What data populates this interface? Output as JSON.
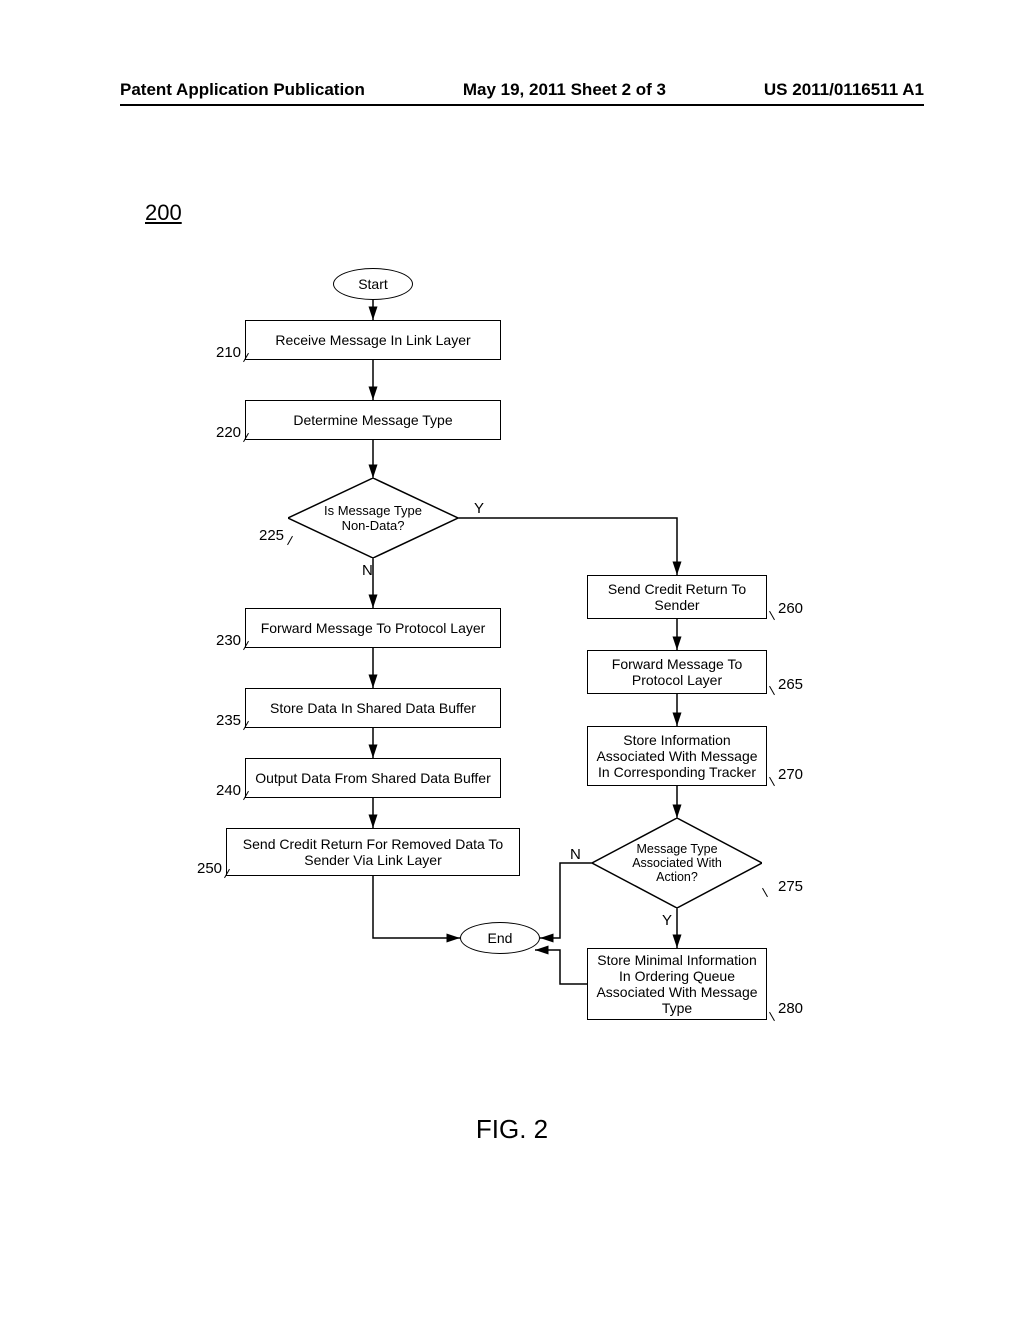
{
  "header": {
    "left": "Patent Application Publication",
    "center": "May 19, 2011  Sheet 2 of 3",
    "right": "US 2011/0116511 A1"
  },
  "figure_number": "200",
  "figure_label": "FIG. 2",
  "terminators": {
    "start": "Start",
    "end": "End"
  },
  "boxes": {
    "b210": "Receive Message In Link Layer",
    "b220": "Determine Message Type",
    "b230": "Forward Message To Protocol Layer",
    "b235": "Store Data In Shared Data Buffer",
    "b240": "Output Data From Shared Data Buffer",
    "b250": "Send Credit Return For Removed Data To Sender Via Link Layer",
    "b260": "Send Credit Return To Sender",
    "b265": "Forward Message To Protocol Layer",
    "b270": "Store Information Associated With Message In Corresponding Tracker",
    "b280": "Store Minimal Information In Ordering Queue Associated With Message Type"
  },
  "decisions": {
    "d225": "Is Message Type Non-Data?",
    "d275": "Message Type Associated With Action?"
  },
  "refs": {
    "r210": "210",
    "r220": "220",
    "r225": "225",
    "r230": "230",
    "r235": "235",
    "r240": "240",
    "r250": "250",
    "r260": "260",
    "r265": "265",
    "r270": "270",
    "r275": "275",
    "r280": "280"
  },
  "branch_labels": {
    "Y": "Y",
    "N": "N"
  },
  "chart_data": {
    "type": "flowchart",
    "nodes": [
      {
        "id": "start",
        "kind": "terminator",
        "label": "Start"
      },
      {
        "id": "210",
        "kind": "process",
        "label": "Receive Message In Link Layer"
      },
      {
        "id": "220",
        "kind": "process",
        "label": "Determine Message Type"
      },
      {
        "id": "225",
        "kind": "decision",
        "label": "Is Message Type Non-Data?"
      },
      {
        "id": "230",
        "kind": "process",
        "label": "Forward Message To Protocol Layer"
      },
      {
        "id": "235",
        "kind": "process",
        "label": "Store Data In Shared Data Buffer"
      },
      {
        "id": "240",
        "kind": "process",
        "label": "Output Data From Shared Data Buffer"
      },
      {
        "id": "250",
        "kind": "process",
        "label": "Send Credit Return For Removed Data To Sender Via Link Layer"
      },
      {
        "id": "260",
        "kind": "process",
        "label": "Send Credit Return To Sender"
      },
      {
        "id": "265",
        "kind": "process",
        "label": "Forward Message To Protocol Layer"
      },
      {
        "id": "270",
        "kind": "process",
        "label": "Store Information Associated With Message In Corresponding Tracker"
      },
      {
        "id": "275",
        "kind": "decision",
        "label": "Message Type Associated With Action?"
      },
      {
        "id": "280",
        "kind": "process",
        "label": "Store Minimal Information In Ordering Queue Associated With Message Type"
      },
      {
        "id": "end",
        "kind": "terminator",
        "label": "End"
      }
    ],
    "edges": [
      {
        "from": "start",
        "to": "210"
      },
      {
        "from": "210",
        "to": "220"
      },
      {
        "from": "220",
        "to": "225"
      },
      {
        "from": "225",
        "to": "230",
        "label": "N"
      },
      {
        "from": "225",
        "to": "260",
        "label": "Y"
      },
      {
        "from": "230",
        "to": "235"
      },
      {
        "from": "235",
        "to": "240"
      },
      {
        "from": "240",
        "to": "250"
      },
      {
        "from": "250",
        "to": "end"
      },
      {
        "from": "260",
        "to": "265"
      },
      {
        "from": "265",
        "to": "270"
      },
      {
        "from": "270",
        "to": "275"
      },
      {
        "from": "275",
        "to": "280",
        "label": "Y"
      },
      {
        "from": "275",
        "to": "end",
        "label": "N"
      },
      {
        "from": "280",
        "to": "end"
      }
    ]
  }
}
